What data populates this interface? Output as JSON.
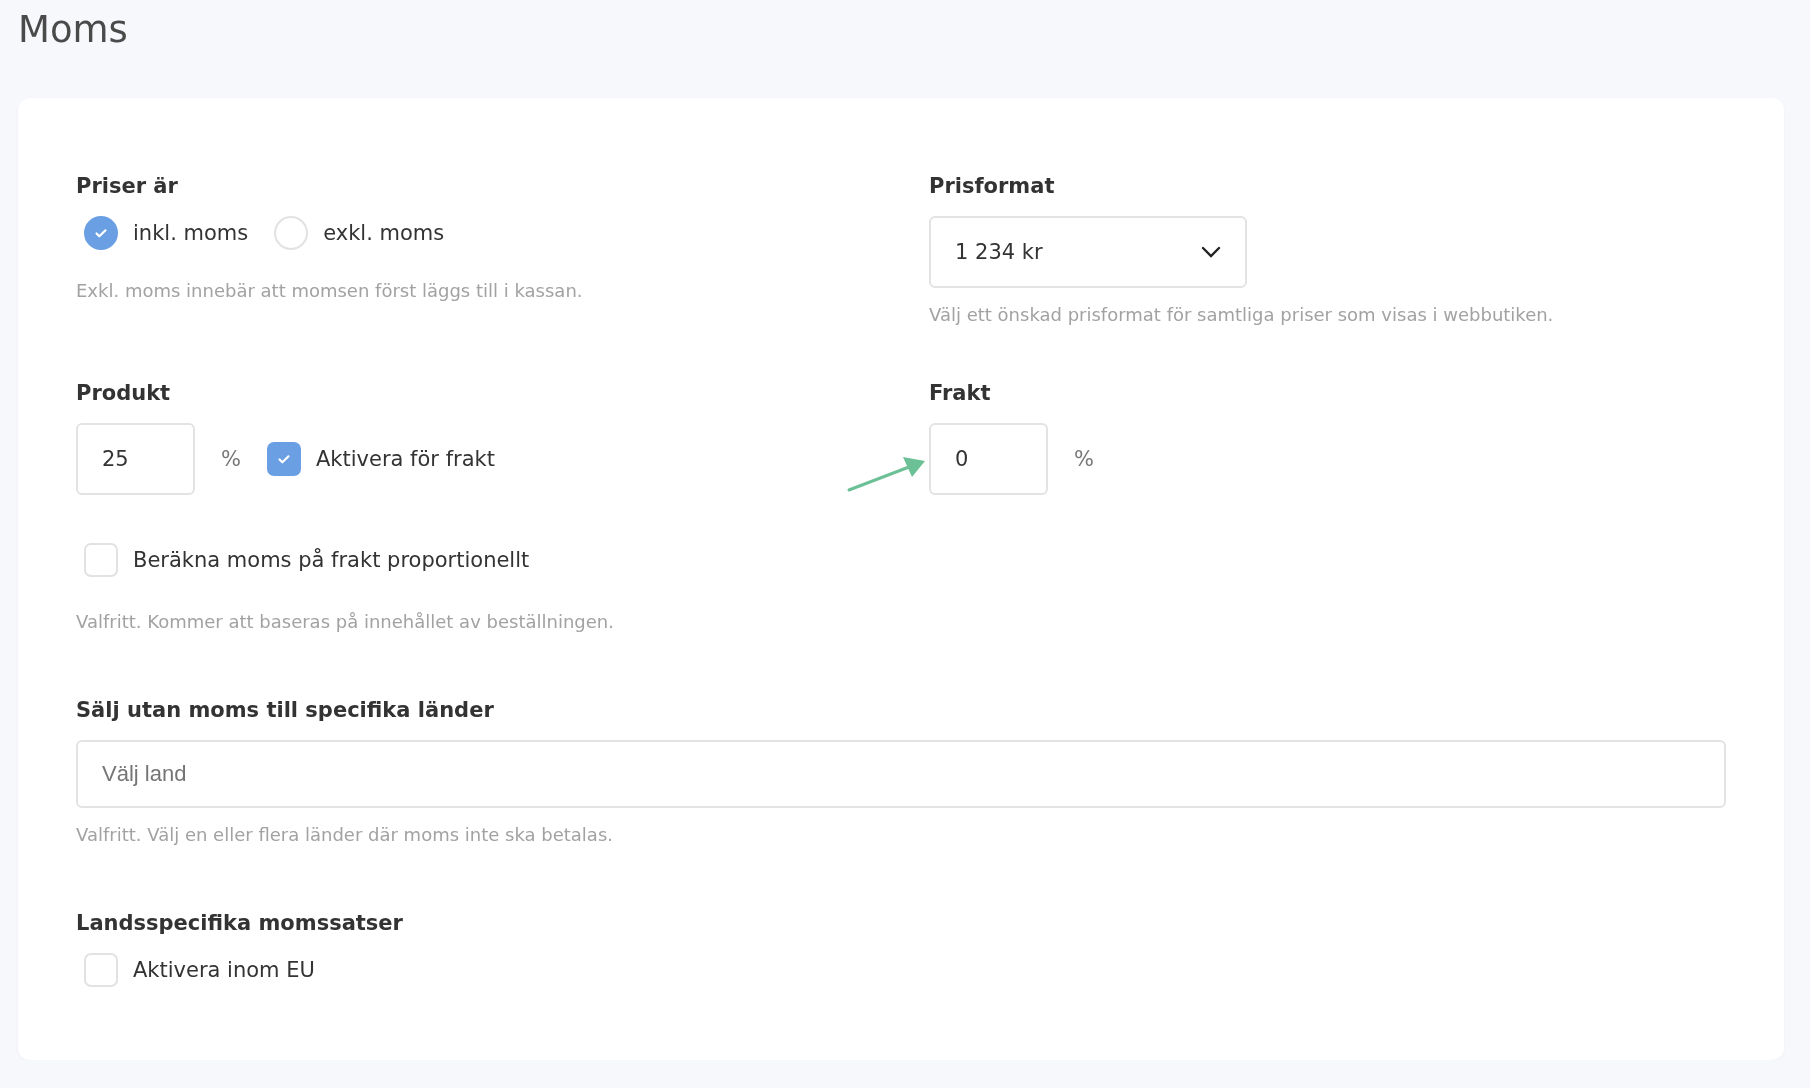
{
  "page_title": "Moms",
  "prices": {
    "label": "Priser är",
    "options": [
      {
        "label": "inkl. moms",
        "selected": true
      },
      {
        "label": "exkl. moms",
        "selected": false
      }
    ],
    "hint": "Exkl. moms innebär att momsen först läggs till i kassan."
  },
  "price_format": {
    "label": "Prisformat",
    "value": "1 234 kr",
    "hint": "Välj ett önskad prisformat för samtliga priser som visas i webbutiken."
  },
  "product": {
    "label": "Produkt",
    "value": "25",
    "unit": "%",
    "shipping_checkbox": {
      "label": "Aktivera för frakt",
      "checked": true
    }
  },
  "shipping": {
    "label": "Frakt",
    "value": "0",
    "unit": "%"
  },
  "proportional": {
    "label": "Beräkna moms på frakt proportionellt",
    "checked": false,
    "hint": "Valfritt. Kommer att baseras på innehållet av beställningen."
  },
  "vat_free_countries": {
    "label": "Sälj utan moms till specifika länder",
    "placeholder": "Välj land",
    "hint": "Valfritt. Välj en eller flera länder där moms inte ska betalas."
  },
  "country_rates": {
    "label": "Landsspecifika momssatser",
    "checkbox": {
      "label": "Aktivera inom EU",
      "checked": false
    }
  }
}
